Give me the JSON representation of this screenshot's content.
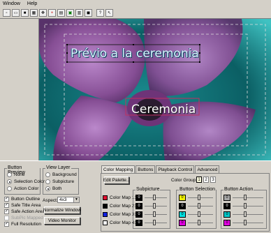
{
  "menu": {
    "items": [
      "Window",
      "Help"
    ]
  },
  "toolbar": {
    "icons": [
      "new-document-icon",
      "open-icon",
      "save-icon",
      "grid-icon",
      "move-icon",
      "crosshair-icon",
      "video-icon",
      "image-icon",
      "film-icon",
      "render-icon",
      "help-icon",
      "context-help-icon"
    ]
  },
  "canvas": {
    "title_text": "Prévio a la ceremonia",
    "action_text": "Ceremonia",
    "colors": {
      "background": "#0b5f64",
      "petal": "#9a5ba2",
      "center": "#1d1520",
      "selection_outline": "#c03060"
    }
  },
  "button_preview": {
    "title": "Button Preview",
    "options": [
      "None",
      "Selection Color",
      "Action Color"
    ],
    "selected": "Selection Color"
  },
  "view_layer": {
    "title": "View Layer",
    "options": [
      "Background",
      "Subpicture",
      "Both"
    ],
    "selected": "Both"
  },
  "checks": [
    {
      "label": "Button Outline",
      "checked": true,
      "enabled": true
    },
    {
      "label": "Safe Title Area",
      "checked": true,
      "enabled": true
    },
    {
      "label": "Safe Action Area",
      "checked": true,
      "enabled": true
    },
    {
      "label": "SubPic Mapped",
      "checked": false,
      "enabled": false
    },
    {
      "label": "Full Resolution",
      "checked": true,
      "enabled": true
    }
  ],
  "aspect": {
    "label": "Aspect:",
    "value": "4x3"
  },
  "buttons": {
    "normalize": "Normalize Window",
    "video_monitor": "Video Monitor",
    "edit_palette": "Edit Palette..."
  },
  "tabs": [
    {
      "label": "Color Mapping",
      "active": true
    },
    {
      "label": "Buttons",
      "active": false
    },
    {
      "label": "Playback Control",
      "active": false
    },
    {
      "label": "Advanced",
      "active": false
    }
  ],
  "color_group": {
    "label": "Color Group:",
    "values": [
      "1",
      "2",
      "3"
    ],
    "active": "1"
  },
  "color_maps": [
    {
      "label": "Color Map 1:",
      "swatch": "#e01030"
    },
    {
      "label": "Color Map 2:",
      "swatch": "#000000"
    },
    {
      "label": "Color Map 3:",
      "swatch": "#1020e0"
    },
    {
      "label": "Color Map 4:",
      "swatch": "#ffffff"
    }
  ],
  "columns": {
    "subpicture": {
      "title": "Subpicture",
      "cells": [
        {
          "value": "0",
          "color": "#000000"
        },
        {
          "value": "0",
          "color": "#000000"
        },
        {
          "value": "0",
          "color": "#000000"
        },
        {
          "value": "0",
          "color": "#000000"
        }
      ]
    },
    "button_selection": {
      "title": "Button Selection",
      "cells": [
        {
          "value": "0",
          "color": "#f0f000"
        },
        {
          "value": "0",
          "color": "#000000"
        },
        {
          "value": "0",
          "color": "#00e0e0"
        },
        {
          "value": "0",
          "color": "#e000e0"
        }
      ]
    },
    "button_action": {
      "title": "Button Action",
      "cells": [
        {
          "value": "0",
          "color": "#a8a8a8"
        },
        {
          "value": "0",
          "color": "#000000"
        },
        {
          "value": "0",
          "color": "#00c8c8"
        },
        {
          "value": "0",
          "color": "#e000e0"
        }
      ]
    }
  }
}
